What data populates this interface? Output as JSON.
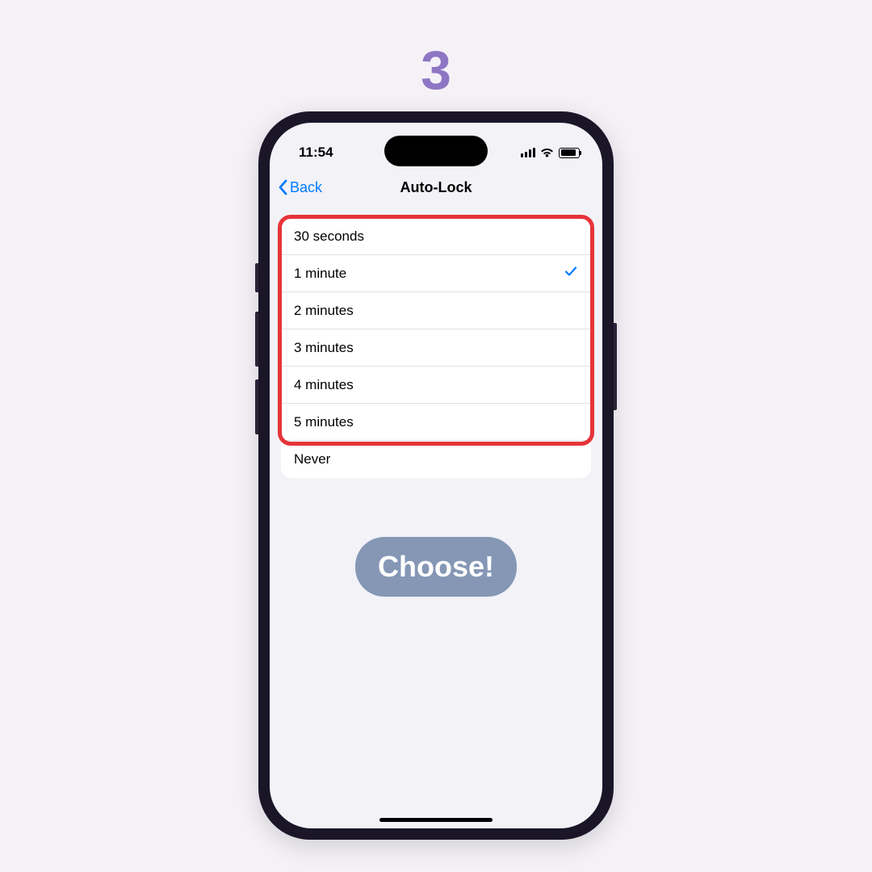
{
  "step_number": "3",
  "status": {
    "time": "11:54"
  },
  "nav": {
    "back_label": "Back",
    "title": "Auto-Lock"
  },
  "options": [
    {
      "label": "30 seconds",
      "selected": false
    },
    {
      "label": "1 minute",
      "selected": true
    },
    {
      "label": "2 minutes",
      "selected": false
    },
    {
      "label": "3 minutes",
      "selected": false
    },
    {
      "label": "4 minutes",
      "selected": false
    },
    {
      "label": "5 minutes",
      "selected": false
    },
    {
      "label": "Never",
      "selected": false
    }
  ],
  "annotation": {
    "choose_label": "Choose!"
  }
}
